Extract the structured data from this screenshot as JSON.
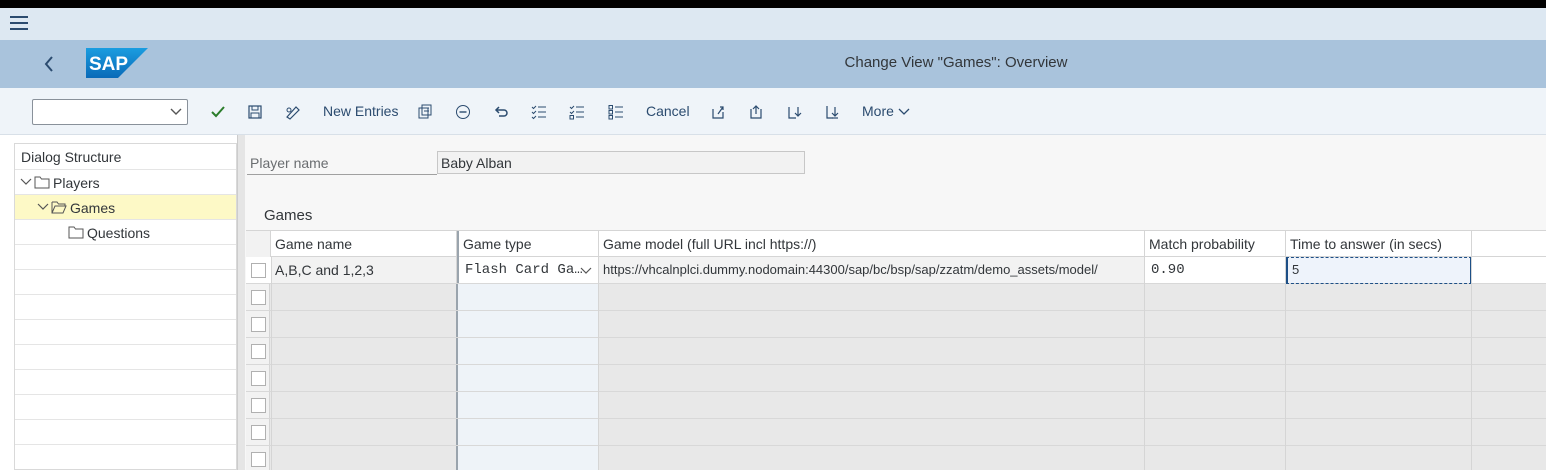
{
  "window": {
    "title": "Change View \"Games\": Overview"
  },
  "toolbar": {
    "command_field_value": "",
    "new_entries_label": "New Entries",
    "cancel_label": "Cancel",
    "more_label": "More"
  },
  "dialog_structure": {
    "header": "Dialog Structure",
    "items": [
      {
        "label": "Players",
        "level": 0,
        "expanded": true
      },
      {
        "label": "Games",
        "level": 1,
        "expanded": true,
        "selected": true
      },
      {
        "label": "Questions",
        "level": 2
      }
    ]
  },
  "player": {
    "label": "Player name",
    "value": "Baby Alban"
  },
  "games_section": {
    "title": "Games",
    "columns": [
      "Game name",
      "Game type",
      "Game model (full URL incl https://)",
      "Match probability",
      "Time to answer (in secs)"
    ],
    "rows": [
      {
        "game_name": "A,B,C and 1,2,3",
        "game_type": "Flash Card Ga…",
        "game_model": "https://vhcalnplci.dummy.nodomain:44300/sap/bc/bsp/sap/zzatm/demo_assets/model/",
        "match_probability": "0.90",
        "time_to_answer": "5"
      }
    ]
  },
  "colors": {
    "header_bg": "#a9c3dc",
    "toolbar_bg": "#eff4f9",
    "selected_row": "#fdf9c6",
    "accept_green": "#2b7d2b"
  }
}
